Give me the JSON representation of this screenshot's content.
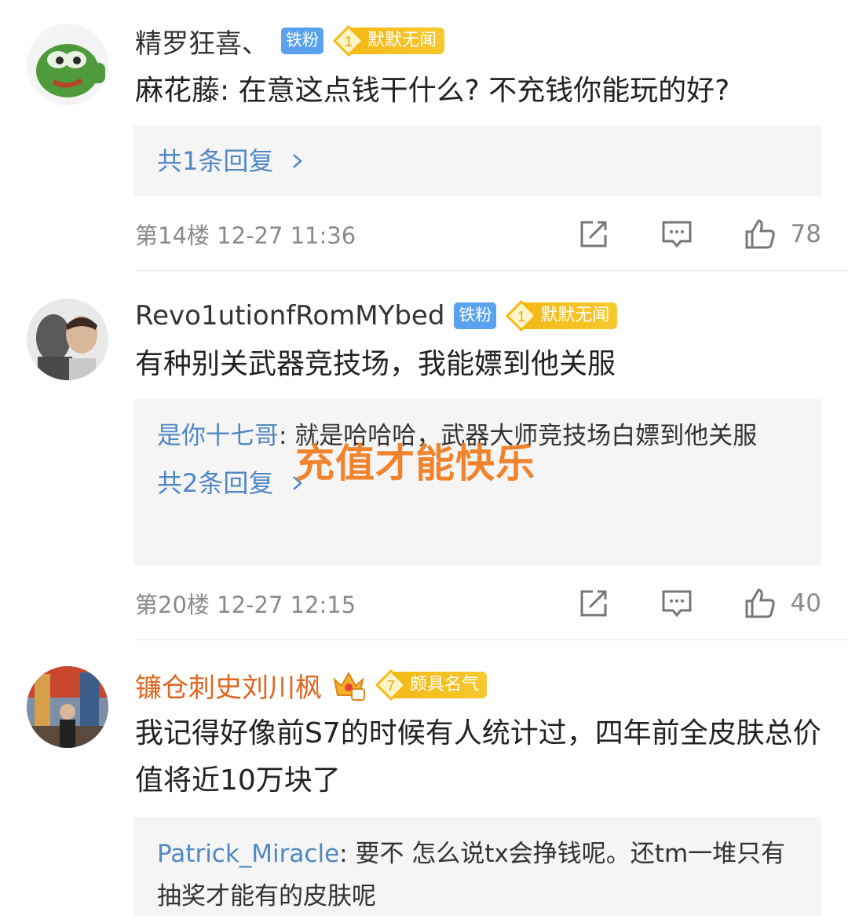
{
  "watermark": "充值才能快乐",
  "posts": [
    {
      "username": "精罗狂喜、",
      "fan_badge": "铁粉",
      "level_num": "1",
      "level_title": "默默无闻",
      "content": "麻花藤: 在意这点钱干什么? 不充钱你能玩的好?",
      "replies": [],
      "reply_count_label": "共1条回复",
      "floor": "第14楼",
      "time": "12-27 11:36",
      "likes": "78"
    },
    {
      "username": "Revo1utionfRomMYbed",
      "fan_badge": "铁粉",
      "level_num": "1",
      "level_title": "默默无闻",
      "content": "有种别关武器竞技场，我能嫖到他关服",
      "replies": [
        {
          "user": "是你十七哥",
          "text": ": 就是哈哈哈，武器大师竞技场白嫖到他关服"
        }
      ],
      "reply_count_label": "共2条回复",
      "floor": "第20楼",
      "time": "12-27 12:15",
      "likes": "40"
    },
    {
      "username": "镰仓刺史刘川枫",
      "level_num": "7",
      "level_title": "颇具名气",
      "content": "我记得好像前S7的时候有人统计过，四年前全皮肤总价值将近10万块了",
      "replies": [
        {
          "user": "Patrick_Miracle",
          "text": ": 要不 怎么说tx会挣钱呢。还tm一堆只有抽奖才能有的皮肤呢"
        }
      ]
    }
  ],
  "icons": {
    "share": "share-icon",
    "comment": "comment-icon",
    "like": "thumbs-up-icon",
    "crown": "crown-icon"
  },
  "colors": {
    "link": "#5187c5",
    "fan_badge": "#5aa2ee",
    "level_badge": "#f3b916",
    "vip_name": "#e0661e",
    "watermark": "#f07a1c"
  }
}
